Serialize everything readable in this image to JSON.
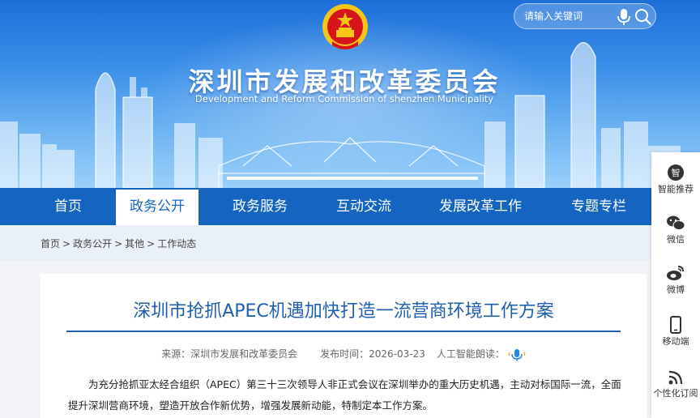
{
  "header": {
    "title": "深圳市发展和改革委员会",
    "subtitle": "Development and Reform Commission of shenzhen Municipality",
    "search_placeholder": "请输入关键词"
  },
  "nav": {
    "items": [
      {
        "label": "首页"
      },
      {
        "label": "政务公开",
        "active": true
      },
      {
        "label": "政务服务"
      },
      {
        "label": "互动交流"
      },
      {
        "label": "发展改革工作"
      },
      {
        "label": "专题专栏"
      }
    ]
  },
  "breadcrumb": [
    "首页",
    "政务公开",
    "其他",
    "工作动态"
  ],
  "breadcrumb_separator": ">",
  "article": {
    "title": "深圳市抢抓APEC机遇加快打造一流营商环境工作方案",
    "source": "来源：深圳市发展和改革委员会",
    "published": "发布时间：2026-03-23",
    "ai_read": "人工智能朗读：",
    "body": "为充分抢抓亚太经合组织（APEC）第三十三次领导人非正式会议在深圳举办的重大历史机遇，主动对标国际一流，全面提升深圳营商环境，塑造开放合作新优势，增强发展新动能，特制定本工作方案。"
  },
  "floatbar": [
    {
      "label": "智能推荐",
      "icon": "smart-recommend-icon"
    },
    {
      "label": "微信",
      "icon": "wechat-icon"
    },
    {
      "label": "微博",
      "icon": "weibo-icon"
    },
    {
      "label": "移动端",
      "icon": "mobile-icon"
    },
    {
      "label": "个性化订阅",
      "icon": "rss-icon"
    }
  ],
  "colors": {
    "nav_bg": "#1565c0",
    "title_blue": "#1f5fb0",
    "emblem_red": "#d7141a",
    "emblem_gold": "#f5c518"
  }
}
